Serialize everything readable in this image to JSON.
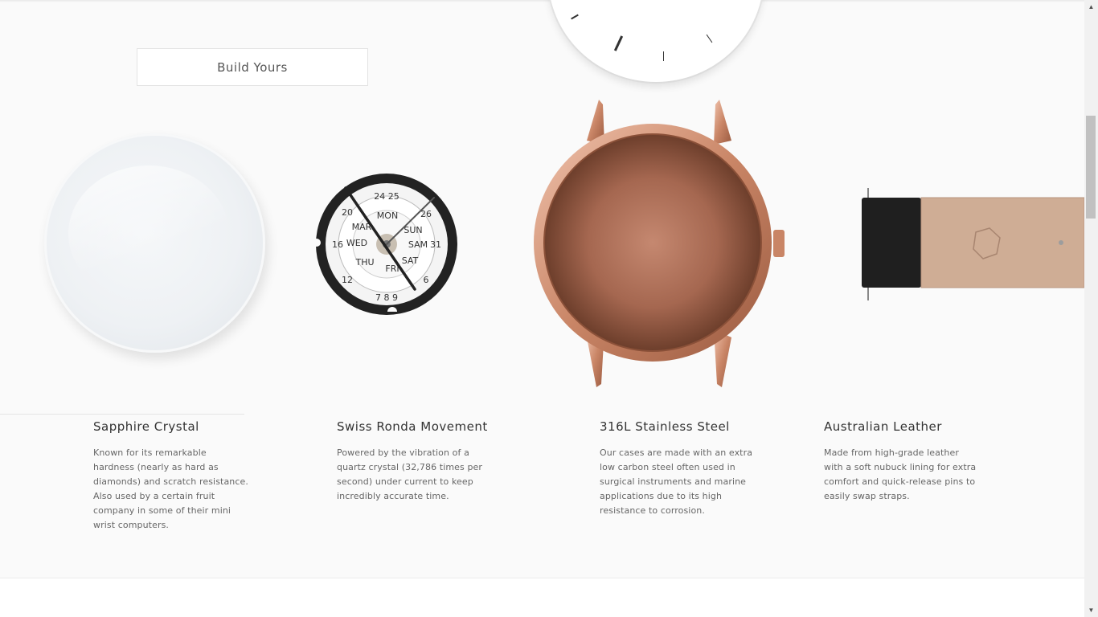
{
  "hero": {
    "build_button_label": "Build Yours"
  },
  "components": [
    {
      "title": "Sapphire Crystal",
      "lines": [
        "Known for its remarkable",
        "hardness (nearly as hard as",
        "diamonds) and scratch resistance.",
        "Also used by a certain fruit",
        "company in some of their mini",
        "wrist computers."
      ]
    },
    {
      "title": "Swiss Ronda Movement",
      "lines": [
        "Powered by the vibration of a",
        "quartz crystal (32,786 times per",
        "second) under current to keep",
        "incredibly accurate time."
      ]
    },
    {
      "title": "316L Stainless Steel",
      "lines": [
        "Our cases are made with an extra",
        "low carbon steel often used in",
        "surgical instruments and marine",
        "applications due to its high",
        "resistance to corrosion."
      ]
    },
    {
      "title": "Australian Leather",
      "lines": [
        "Made from high-grade leather",
        "with a soft nubuck lining for extra",
        "comfort and quick-release pins to",
        "easily swap straps."
      ]
    }
  ],
  "colors": {
    "background": "#fafafa",
    "copper": "#b8735a",
    "text": "#333333"
  }
}
